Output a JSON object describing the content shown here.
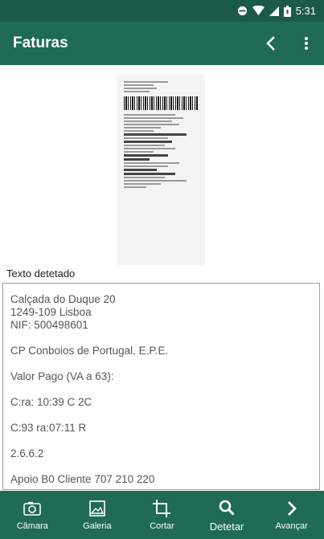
{
  "status_bar": {
    "time": "5:31"
  },
  "app_bar": {
    "title": "Faturas"
  },
  "section": {
    "detected_label": "Texto detetado"
  },
  "detected_text": {
    "address_lines": [
      "Calçada do Duque 20",
      "1249-109 Lisboa",
      "NIF: 500498601"
    ],
    "lines": [
      "CP Conboios de Portugal, E.P.E.",
      "Valor Pago (VA a 63):",
      "C:ra: 10:39 C 2C",
      "C:93 ra:07:11 R",
      "2.6.6.2",
      "Apoio B0 Cliente 707 210 220"
    ]
  },
  "bottom_nav": {
    "items": [
      {
        "label": "Câmara",
        "icon": "camera-icon"
      },
      {
        "label": "Galeria",
        "icon": "image-icon"
      },
      {
        "label": "Cortar",
        "icon": "crop-icon"
      },
      {
        "label": "Detetar",
        "icon": "search-icon"
      },
      {
        "label": "Avançar",
        "icon": "chevron-right-icon"
      }
    ]
  }
}
